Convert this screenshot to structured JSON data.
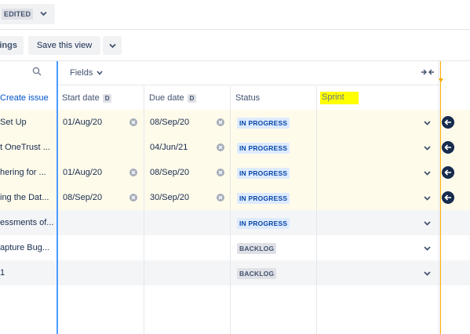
{
  "topbar": {
    "edited_label": "EDITED"
  },
  "toolbar": {
    "settings_label": "ings",
    "save_view_label": "Save this view"
  },
  "fields": {
    "label": "Fields"
  },
  "columns": {
    "create_issue": "Create issue",
    "start_date": "Start date",
    "due_date": "Due date",
    "status": "Status",
    "sprint": "Sprint",
    "date_badge": "D"
  },
  "rows": [
    {
      "summary": "Set Up",
      "start": "01/Aug/20",
      "due": "08/Sep/20",
      "status": "IN PROGRESS"
    },
    {
      "summary": "t OneTrust ...",
      "start": "",
      "due": "04/Jun/21",
      "status": "IN PROGRESS"
    },
    {
      "summary": "hering for ...",
      "start": "01/Aug/20",
      "due": "08/Sep/20",
      "status": "IN PROGRESS"
    },
    {
      "summary": "ing the Dat...",
      "start": "08/Sep/20",
      "due": "30/Sep/20",
      "status": "IN PROGRESS"
    },
    {
      "summary": "essments of...",
      "start": "",
      "due": "",
      "status": "IN PROGRESS"
    },
    {
      "summary": "apture Bug...",
      "start": "",
      "due": "",
      "status": "BACKLOG"
    },
    {
      "summary": "1",
      "start": "",
      "due": "",
      "status": "BACKLOG"
    }
  ],
  "colors": {
    "accent": "#0052cc",
    "highlight_row": "#fffbeb",
    "sprint_highlight": "#ffff00",
    "timeline_marker": "#ffab00"
  }
}
